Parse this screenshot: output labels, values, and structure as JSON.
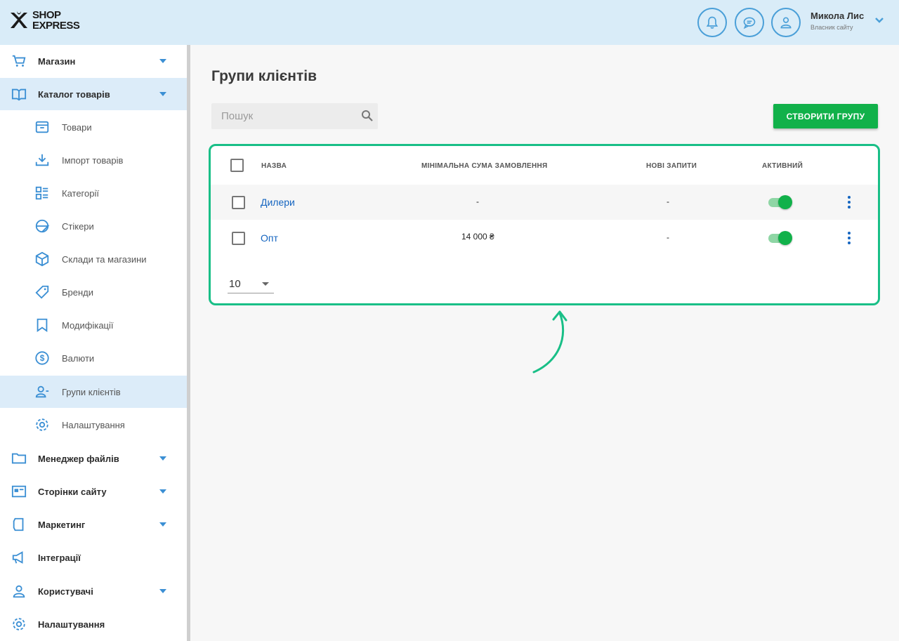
{
  "header": {
    "logo_line1": "SHOP",
    "logo_line2": "EXPRESS",
    "icons": [
      "bell-icon",
      "chat-icon",
      "user-icon"
    ],
    "user_name": "Микола Лис",
    "user_role": "Власник сайту",
    "bg_color": "#d9ecf8",
    "accent_color": "#4a9fd8"
  },
  "sidebar": {
    "items": [
      {
        "label": "Магазин",
        "icon": "cart-icon",
        "expandable": true
      },
      {
        "label": "Каталог товарів",
        "icon": "catalog-icon",
        "expandable": true,
        "active": true
      },
      {
        "label": "Товари",
        "icon": "box-icon",
        "sub": true
      },
      {
        "label": "Імпорт товарів",
        "icon": "download-icon",
        "sub": true
      },
      {
        "label": "Категорії",
        "icon": "categories-icon",
        "sub": true
      },
      {
        "label": "Стікери",
        "icon": "sticker-icon",
        "sub": true
      },
      {
        "label": "Склади та магазини",
        "icon": "warehouse-icon",
        "sub": true
      },
      {
        "label": "Бренди",
        "icon": "tag-icon",
        "sub": true
      },
      {
        "label": "Модифікації",
        "icon": "bookmark-icon",
        "sub": true
      },
      {
        "label": "Валюти",
        "icon": "dollar-icon",
        "sub": true
      },
      {
        "label": "Групи клієнтів",
        "icon": "user-group-icon",
        "sub": true,
        "active": true
      },
      {
        "label": "Налаштування",
        "icon": "gear-icon",
        "sub": true
      },
      {
        "label": "Менеджер файлів",
        "icon": "folder-icon",
        "expandable": true
      },
      {
        "label": "Сторінки сайту",
        "icon": "page-icon",
        "expandable": true
      },
      {
        "label": "Маркетинг",
        "icon": "marketing-icon",
        "expandable": true
      },
      {
        "label": "Інтеграції",
        "icon": "megaphone-icon"
      },
      {
        "label": "Користувачі",
        "icon": "user-icon",
        "expandable": true
      },
      {
        "label": "Налаштування",
        "icon": "gear-icon"
      }
    ]
  },
  "main": {
    "title": "Групи клієнтів",
    "search_placeholder": "Пошук",
    "create_button": "СТВОРИТИ ГРУПУ",
    "table": {
      "columns": [
        "НАЗВА",
        "МІНІМАЛЬНА СУМА ЗАМОВЛЕННЯ",
        "НОВІ ЗАПИТИ",
        "АКТИВНИЙ"
      ],
      "rows": [
        {
          "name": "Дилери",
          "min_sum": "-",
          "new_requests": "-",
          "active": true
        },
        {
          "name": "Опт",
          "min_sum": "14 000 ₴",
          "new_requests": "-",
          "active": true
        }
      ]
    },
    "page_size": "10",
    "highlight_color": "#19bf87",
    "button_color": "#11b14a",
    "link_color": "#1565c0"
  }
}
